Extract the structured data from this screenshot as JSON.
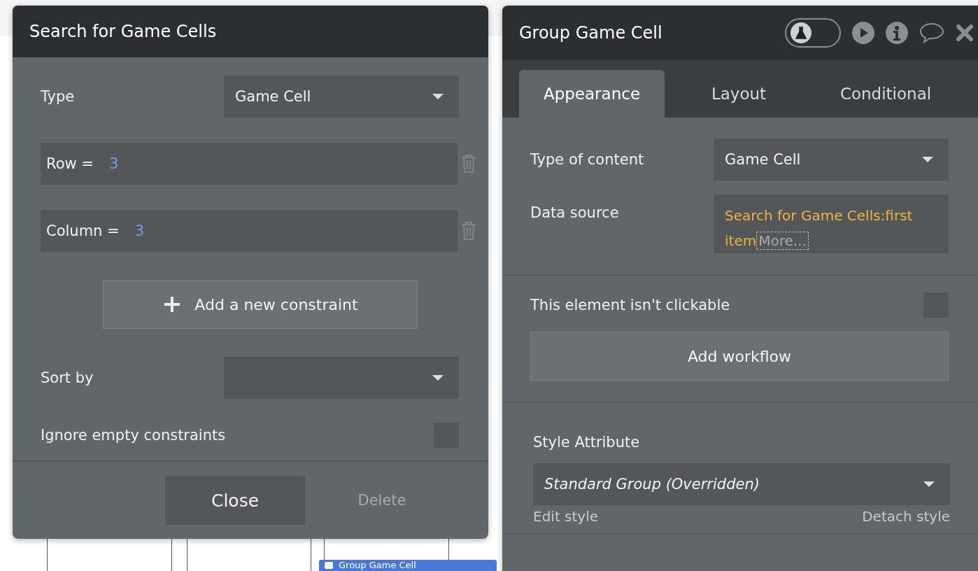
{
  "search_panel": {
    "title": "Search for Game Cells",
    "type_label": "Type",
    "type_value": "Game Cell",
    "constraints": [
      {
        "field": "Row =",
        "value": "3"
      },
      {
        "field": "Column =",
        "value": "3"
      }
    ],
    "add_constraint": "Add a new constraint",
    "sort_label": "Sort by",
    "ignore_empty": {
      "label": "Ignore empty constraints",
      "checked": false
    },
    "buttons": [
      "Close",
      "Delete"
    ]
  },
  "property_panel": {
    "title": "Group Game Cell",
    "test_mode": {
      "on": false
    },
    "tabs": [
      {
        "label": "Appearance",
        "selected": true
      },
      {
        "label": "Layout",
        "selected": false
      },
      {
        "label": "Conditional",
        "selected": false
      }
    ],
    "content_type_label": "Type of content",
    "content_type_value": "Game Cell",
    "data_source_label": "Data source",
    "data_source_value": "Search for Game Cells:first item",
    "data_source_more": "More...",
    "not_clickable": {
      "label": "This element isn't clickable",
      "checked": false
    },
    "add_workflow": "Add workflow",
    "style_label": "Style Attribute",
    "style_value": "Standard Group (Overridden)",
    "edit_style": "Edit style",
    "detach_style": "Detach style"
  },
  "canvas": {
    "element_label": "Group Game Cell"
  }
}
